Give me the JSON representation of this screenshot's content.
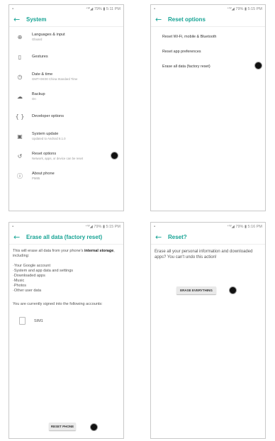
{
  "p1": {
    "status_time": "⁺ᵂ◢ 79% ▮ 5:11 PM",
    "title": "System",
    "items": [
      {
        "icon": "globe-icon",
        "glyph": "⊕",
        "title": "Languages & input",
        "sub": "Gboard"
      },
      {
        "icon": "gestures-icon",
        "glyph": "▯",
        "title": "Gestures",
        "sub": ""
      },
      {
        "icon": "clock-icon",
        "glyph": "◷",
        "title": "Date & time",
        "sub": "GMT+08:00 China Standard Time"
      },
      {
        "icon": "cloud-upload-icon",
        "glyph": "☁",
        "title": "Backup",
        "sub": "On"
      },
      {
        "icon": "code-icon",
        "glyph": "{ }",
        "title": "Developer options",
        "sub": ""
      },
      {
        "icon": "system-update-icon",
        "glyph": "▣",
        "title": "System update",
        "sub": "Updated to Android 8.1.0"
      },
      {
        "icon": "history-icon",
        "glyph": "↺",
        "title": "Reset options",
        "sub": "Network, apps, or device can be reset"
      },
      {
        "icon": "info-icon",
        "glyph": "ⓘ",
        "title": "About phone",
        "sub": "PM85"
      }
    ]
  },
  "p2": {
    "status_time": "⁺ᵂ◢ 79% ▮ 5:15 PM",
    "title": "Reset options",
    "options": [
      "Reset Wi-Fi, mobile & Bluetooth",
      "Reset app preferences",
      "Erase all data (factory reset)"
    ]
  },
  "p3": {
    "status_time": "⁺ᵂ◢ 79% ▮ 5:15 PM",
    "title": "Erase all data (factory reset)",
    "intro_a": "This will erase all data from your phone's",
    "intro_b": "internal storage",
    "intro_c": ", including:",
    "list": [
      "·Your Google account",
      "·System and app data and settings",
      "·Downloaded apps",
      "·Music",
      "·Photos",
      "·Other user data"
    ],
    "signed_in": "You are currently signed into the following accounts:",
    "sim_label": "SIM1",
    "button": "RESET PHONE"
  },
  "p4": {
    "status_time": "⁺ᵂ◢ 79% ▮ 5:16 PM",
    "title": "Reset?",
    "message": "Erase all your personal information and downloaded apps? You can't undo this action!",
    "button": "ERASE EVERYTHING"
  }
}
